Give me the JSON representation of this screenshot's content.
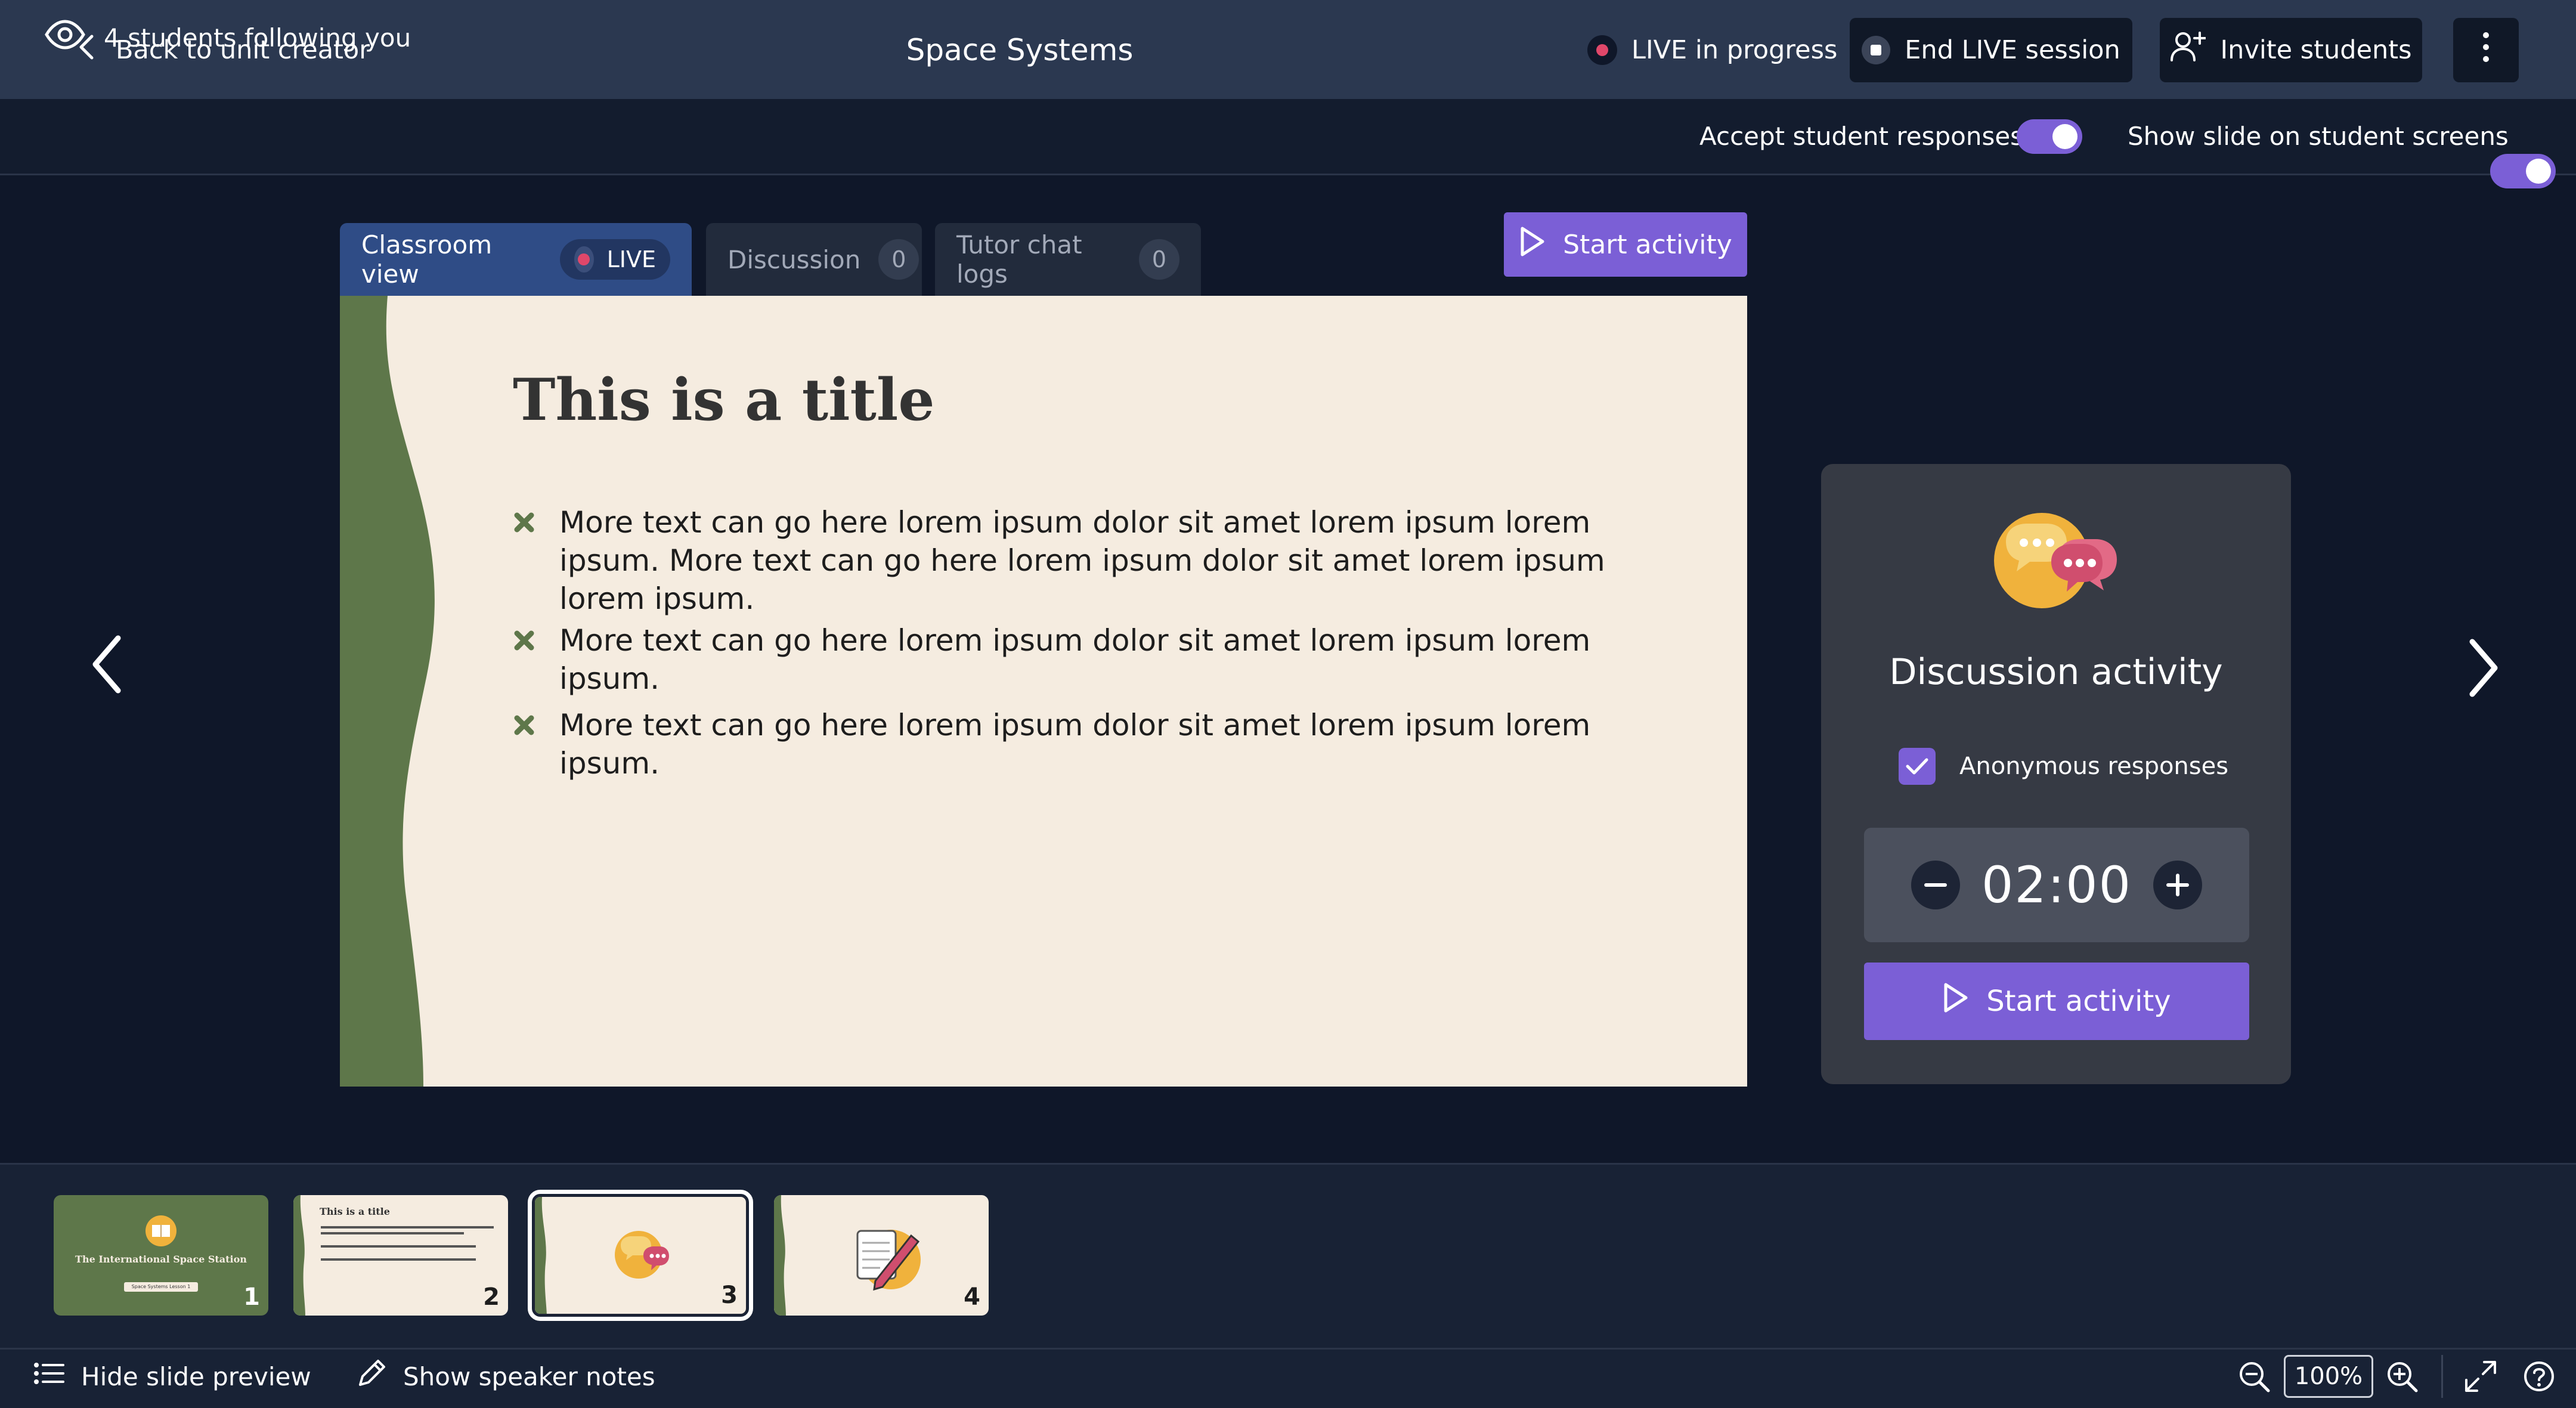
{
  "header": {
    "back_label": "Back to unit creator",
    "title": "Space Systems",
    "live_status": "LIVE in progress",
    "end_session_label": "End LIVE session",
    "invite_label": "Invite students"
  },
  "subbar": {
    "followers": "4 students following you",
    "accept_responses_label": "Accept student responses",
    "accept_responses_on": true,
    "show_slide_label": "Show slide on student screens",
    "show_slide_on": true
  },
  "tabs": [
    {
      "label": "Classroom view",
      "badge": "LIVE",
      "active": true
    },
    {
      "label": "Discussion",
      "badge": "0",
      "active": false
    },
    {
      "label": "Tutor chat logs",
      "badge": "0",
      "active": false
    }
  ],
  "start_activity_label": "Start activity",
  "slide": {
    "title": "This is a title",
    "bullets": [
      "More text can go here lorem ipsum dolor sit amet lorem ipsum lorem ipsum. More text can go here lorem ipsum dolor sit amet lorem ipsum lorem ipsum.",
      "More text can go here lorem ipsum dolor sit amet lorem ipsum lorem ipsum.",
      "More text can go here lorem ipsum dolor sit amet lorem ipsum lorem ipsum."
    ]
  },
  "panel": {
    "title": "Discussion activity",
    "anonymous_label": "Anonymous responses",
    "anonymous_checked": true,
    "timer": "02:00",
    "start_label": "Start activity"
  },
  "thumbnails": [
    {
      "number": "1",
      "title": "The International Space Station",
      "subtitle": "Space Systems Lesson 1"
    },
    {
      "number": "2",
      "title": "This is a title"
    },
    {
      "number": "3",
      "selected": true
    },
    {
      "number": "4"
    }
  ],
  "footer": {
    "hide_preview_label": "Hide slide preview",
    "speaker_notes_label": "Show speaker notes",
    "zoom": "100%"
  },
  "colors": {
    "accent": "#7b5fd6",
    "live_red": "#e0476a",
    "slide_green": "#5e774a",
    "slide_bg": "#f5ece0"
  }
}
